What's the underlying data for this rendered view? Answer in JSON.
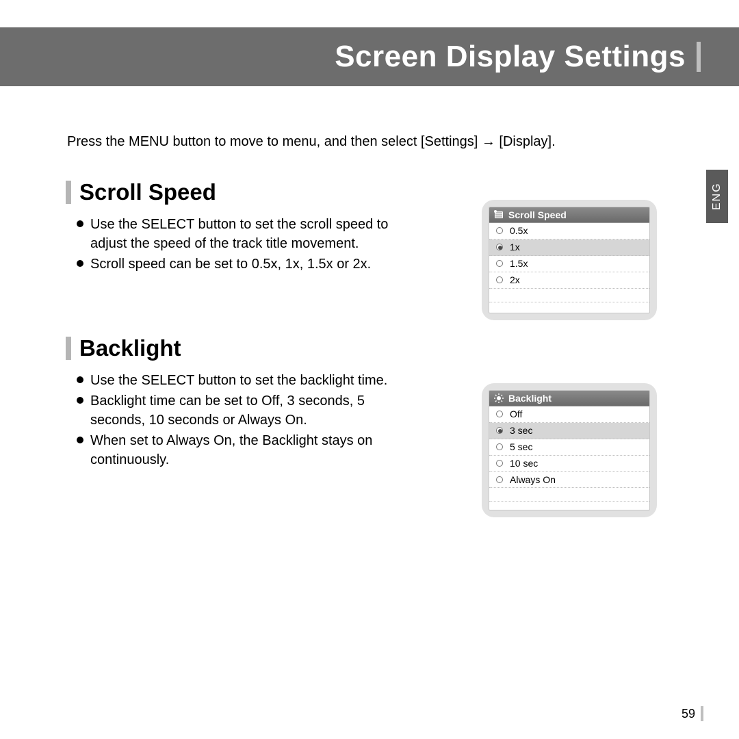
{
  "header": {
    "title": "Screen Display Settings"
  },
  "intro": "Press the MENU button to move to menu, and then select [Settings] → [Display].",
  "side_tab": "ENG",
  "page_number": "59",
  "sections": {
    "scroll": {
      "title": "Scroll Speed",
      "bullets": [
        "Use the SELECT button to set the scroll speed to adjust the speed of the track title movement.",
        "Scroll speed can be set to 0.5x, 1x, 1.5x or 2x."
      ],
      "menu": {
        "header": "Scroll Speed",
        "selected": "1x",
        "options": [
          "0.5x",
          "1x",
          "1.5x",
          "2x"
        ]
      }
    },
    "backlight": {
      "title": "Backlight",
      "bullets": [
        "Use the SELECT button to set the backlight time.",
        "Backlight time can be set to Off, 3 seconds, 5 seconds, 10 seconds or Always On.",
        "When set to Always On, the Backlight stays on continuously."
      ],
      "menu": {
        "header": "Backlight",
        "selected": "3 sec",
        "options": [
          "Off",
          "3 sec",
          "5 sec",
          "10 sec",
          "Always On"
        ]
      }
    }
  }
}
